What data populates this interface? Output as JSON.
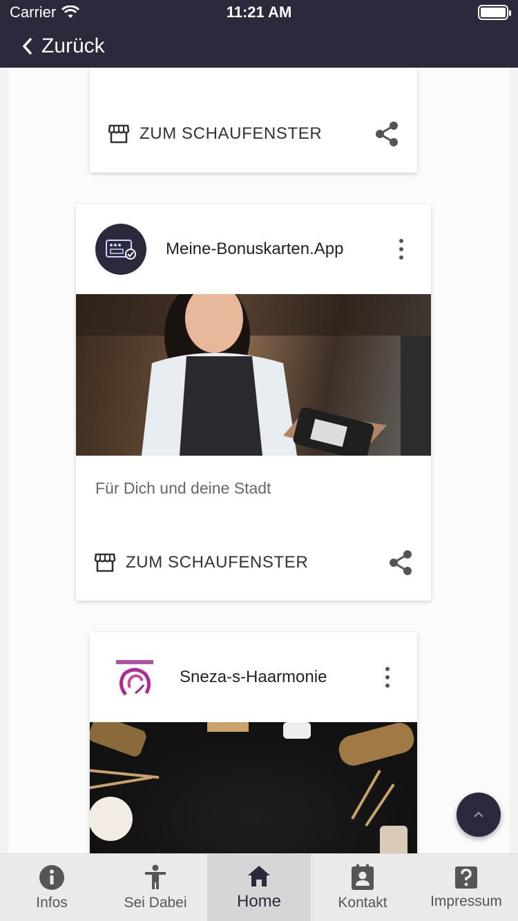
{
  "status": {
    "carrier": "Carrier",
    "time": "11:21 AM"
  },
  "nav": {
    "back_label": "Zurück"
  },
  "cards": [
    {
      "action_label": "ZUM SCHAUFENSTER"
    },
    {
      "title": "Meine-Bonuskarten.App",
      "description": "Für Dich und deine Stadt",
      "action_label": "ZUM SCHAUFENSTER"
    },
    {
      "title": "Sneza-s-Haarmonie"
    }
  ],
  "tabs": [
    {
      "label": "Infos",
      "icon": "info-icon"
    },
    {
      "label": "Sei Dabei",
      "icon": "person-icon"
    },
    {
      "label": "Home",
      "icon": "home-icon",
      "active": true
    },
    {
      "label": "Kontakt",
      "icon": "contact-icon"
    },
    {
      "label": "Impressum",
      "icon": "help-icon"
    }
  ],
  "colors": {
    "header": "#2b2a3d",
    "tabbar": "#eaeaea",
    "accent": "#2b2a3d"
  }
}
